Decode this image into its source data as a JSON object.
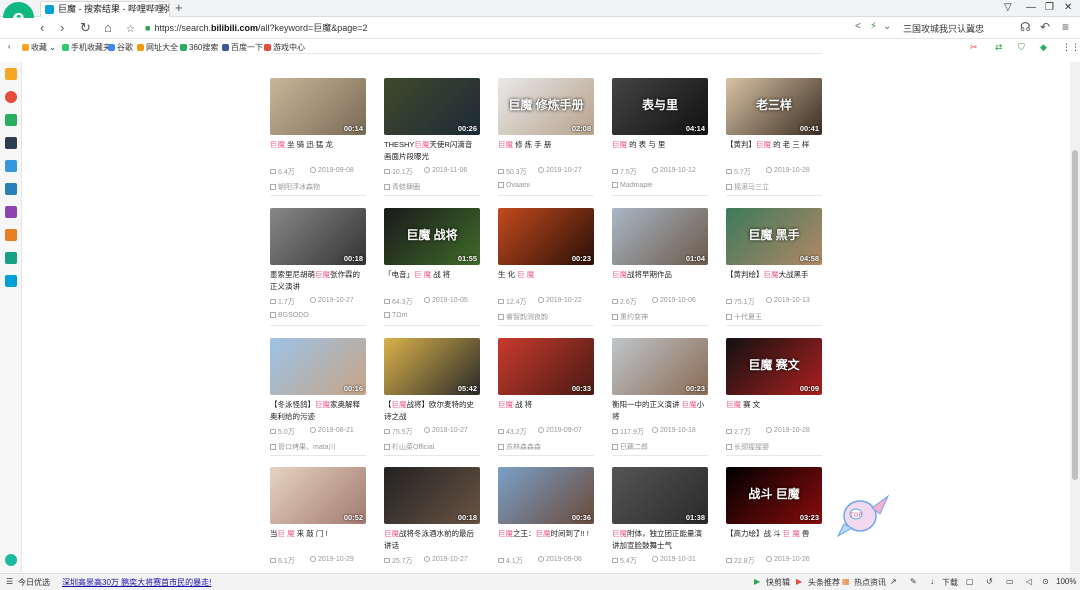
{
  "browser": {
    "tab_title": "巨魔 - 搜索结果 - 哔哩哔哩弹幕",
    "new_tab": "+",
    "tab_close": "×",
    "url_prefix": "https://search.",
    "url_host": "bilibili.com",
    "url_path": "/all?keyword=巨魔&page=2",
    "hot_word": "三国攻城我只认冀忠",
    "logo_letter": "e"
  },
  "bookmarks": [
    {
      "label": "收藏",
      "color": "#f5a623"
    },
    {
      "label": "手机收藏夹",
      "color": "#2ecc71"
    },
    {
      "label": "谷歌",
      "color": "#4285f4"
    },
    {
      "label": "网址大全",
      "color": "#f39c12"
    },
    {
      "label": "360搜索",
      "color": "#27ae60"
    },
    {
      "label": "百度一下",
      "color": "#3b5998"
    },
    {
      "label": "游戏中心",
      "color": "#e74c3c"
    }
  ],
  "videos": [
    {
      "title_parts": [
        {
          "t": "巨魔",
          "hl": true
        },
        {
          "t": " 坐 骑 迅 猛 龙",
          "hl": false
        }
      ],
      "duration": "00:14",
      "views": "6.4万",
      "date": "2019-09-08",
      "author": "朝阳浮冰森物",
      "thumb": [
        "#c9b79a",
        "#7a6a55"
      ]
    },
    {
      "title_parts": [
        {
          "t": "THESHY",
          "hl": false
        },
        {
          "t": "巨魔",
          "hl": true
        },
        {
          "t": "天使R闪滴音 画面片段曝光",
          "hl": false
        }
      ],
      "duration": "00:26",
      "views": "10.1万",
      "date": "2019-11-06",
      "author": "青蛙肆圈",
      "thumb": [
        "#3e4a2a",
        "#1e2a38"
      ]
    },
    {
      "title_parts": [
        {
          "t": "巨魔",
          "hl": true
        },
        {
          "t": " 修 炼 手 册",
          "hl": false
        }
      ],
      "duration": "02:08",
      "views": "50.3万",
      "date": "2019-10-27",
      "author": "Ovaaini",
      "thumb": [
        "#e8e8e8",
        "#b7a28c"
      ],
      "overlay": "巨魔 修炼手册"
    },
    {
      "title_parts": [
        {
          "t": "巨魔",
          "hl": true
        },
        {
          "t": " 的 表 与 里",
          "hl": false
        }
      ],
      "duration": "04:14",
      "views": "7.5万",
      "date": "2019-10-12",
      "author": "Madmaple",
      "thumb": [
        "#444",
        "#111"
      ],
      "overlay": "表与里"
    },
    {
      "title_parts": [
        {
          "t": "【黄判】",
          "hl": false
        },
        {
          "t": "巨魔",
          "hl": true
        },
        {
          "t": " 的 老 三 样",
          "hl": false
        }
      ],
      "duration": "00:41",
      "views": "5.7万",
      "date": "2019-10-28",
      "author": "摇滚马三立",
      "thumb": [
        "#d9c3a5",
        "#3a2d22"
      ],
      "overlay": "老三样"
    },
    {
      "title_parts": [
        {
          "t": "墨索里尼胡萌",
          "hl": false
        },
        {
          "t": "巨魔",
          "hl": true
        },
        {
          "t": "张作霖的 正义演讲",
          "hl": false
        }
      ],
      "duration": "00:18",
      "views": "1.7万",
      "date": "2019-10-27",
      "author": "BGSODO",
      "thumb": [
        "#888",
        "#333"
      ]
    },
    {
      "title_parts": [
        {
          "t": "「电音」",
          "hl": false
        },
        {
          "t": "巨 魔",
          "hl": true
        },
        {
          "t": " 战 将",
          "hl": false
        }
      ],
      "duration": "01:55",
      "views": "64.3万",
      "date": "2019-10-05",
      "author": "TΩm",
      "thumb": [
        "#1a1a1a",
        "#3f6b2a"
      ],
      "overlay": "巨魔 战将"
    },
    {
      "title_parts": [
        {
          "t": "生 化 ",
          "hl": false
        },
        {
          "t": "巨 魔",
          "hl": true
        }
      ],
      "duration": "00:23",
      "views": "12.4万",
      "date": "2019-10-22",
      "author": "睿智韵测良韵",
      "thumb": [
        "#c24a1e",
        "#2a0f08"
      ]
    },
    {
      "title_parts": [
        {
          "t": "巨魔",
          "hl": true
        },
        {
          "t": "战将早期作品",
          "hl": false
        }
      ],
      "duration": "01:04",
      "views": "2.6万",
      "date": "2019-10-06",
      "author": "重约变神",
      "thumb": [
        "#a8b7c6",
        "#6d5a4a"
      ]
    },
    {
      "title_parts": [
        {
          "t": "【黄判绘】",
          "hl": false
        },
        {
          "t": "巨魔",
          "hl": true
        },
        {
          "t": "大战黑手",
          "hl": false
        }
      ],
      "duration": "04:58",
      "views": "75.1万",
      "date": "2019-10-13",
      "author": "十代夏王",
      "thumb": [
        "#3c7a5a",
        "#b28766"
      ],
      "overlay": "巨魔 黑手"
    },
    {
      "title_parts": [
        {
          "t": "【冬泳怪鸽】",
          "hl": false
        },
        {
          "t": "巨魔",
          "hl": true
        },
        {
          "t": "家奥解释 奥利给的污迹",
          "hl": false
        }
      ],
      "duration": "00:16",
      "views": "5.0万",
      "date": "2019-08-21",
      "author": "管口烤果、mata川",
      "thumb": [
        "#9cc3e6",
        "#c7a487"
      ]
    },
    {
      "title_parts": [
        {
          "t": "【",
          "hl": false
        },
        {
          "t": "巨魔",
          "hl": true
        },
        {
          "t": "战将】欧尔麦特的史 诗之战",
          "hl": false
        }
      ],
      "duration": "05:42",
      "views": "75.5万",
      "date": "2019-10-27",
      "author": "杉山菜Official",
      "thumb": [
        "#d9b24a",
        "#2a2a2a"
      ]
    },
    {
      "title_parts": [
        {
          "t": "巨魔",
          "hl": true
        },
        {
          "t": " 战 将",
          "hl": false
        }
      ],
      "duration": "00:33",
      "views": "43.2万",
      "date": "2019-09-07",
      "author": "苏林森森森",
      "thumb": [
        "#c83a2c",
        "#4a1a14"
      ]
    },
    {
      "title_parts": [
        {
          "t": "衡阳一中的正义演讲 ",
          "hl": false
        },
        {
          "t": "巨魔",
          "hl": true
        },
        {
          "t": "小将",
          "hl": false
        }
      ],
      "duration": "00:23",
      "views": "117.9万",
      "date": "2019-10-18",
      "author": "巳藕二郎",
      "thumb": [
        "#bfc6cc",
        "#8a6a52"
      ]
    },
    {
      "title_parts": [
        {
          "t": "巨魔",
          "hl": true
        },
        {
          "t": " 赛 文",
          "hl": false
        }
      ],
      "duration": "00:09",
      "views": "2.7万",
      "date": "2019-10-28",
      "author": "长颈猩猩婴",
      "thumb": [
        "#111",
        "#ad1f1f"
      ],
      "overlay": "巨魔 赛文"
    },
    {
      "title_parts": [
        {
          "t": "当",
          "hl": false
        },
        {
          "t": "巨 魔",
          "hl": true
        },
        {
          "t": " 来 敲 门 !",
          "hl": false
        }
      ],
      "duration": "00:52",
      "views": "6.1万",
      "date": "2019-10-29",
      "author": "",
      "thumb": [
        "#e7d3c2",
        "#a17a70"
      ]
    },
    {
      "title_parts": [
        {
          "t": "巨魔",
          "hl": true
        },
        {
          "t": "战将冬泳酒水前的最后 讲话",
          "hl": false
        }
      ],
      "duration": "00:18",
      "views": "25.7万",
      "date": "2019-10-27",
      "author": "",
      "thumb": [
        "#222",
        "#6a5443"
      ]
    },
    {
      "title_parts": [
        {
          "t": "巨魔",
          "hl": true
        },
        {
          "t": "之王：",
          "hl": false
        },
        {
          "t": "巨魔",
          "hl": true
        },
        {
          "t": "时间到了!! !",
          "hl": false
        }
      ],
      "duration": "00:36",
      "views": "4.1万",
      "date": "2019-09-06",
      "author": "",
      "thumb": [
        "#7aa0c8",
        "#6b4a3a"
      ]
    },
    {
      "title_parts": [
        {
          "t": "巨魔",
          "hl": true
        },
        {
          "t": "附体，独立团正能量演 讲加宣脸鼓舞士气",
          "hl": false
        }
      ],
      "duration": "01:38",
      "views": "5.4万",
      "date": "2019-10-31",
      "author": "",
      "thumb": [
        "#555",
        "#2a2a2a"
      ]
    },
    {
      "title_parts": [
        {
          "t": "【高力绘】",
          "hl": false
        },
        {
          "t": "战 斗 ",
          "hl": false
        },
        {
          "t": "巨 魔",
          "hl": true
        },
        {
          "t": " 兽",
          "hl": false
        }
      ],
      "duration": "03:23",
      "views": "22.8万",
      "date": "2019-10-26",
      "author": "",
      "thumb": [
        "#000",
        "#8a0c0c"
      ],
      "overlay": "战斗 巨魔"
    }
  ],
  "status": {
    "today": "今日优选",
    "news": "深圳高景高30万 鹏奕大将赛首市民的暴走!",
    "items": [
      "快剪辑",
      "头条推荐",
      "热点资讯",
      "下载"
    ],
    "zoom": "100%"
  }
}
